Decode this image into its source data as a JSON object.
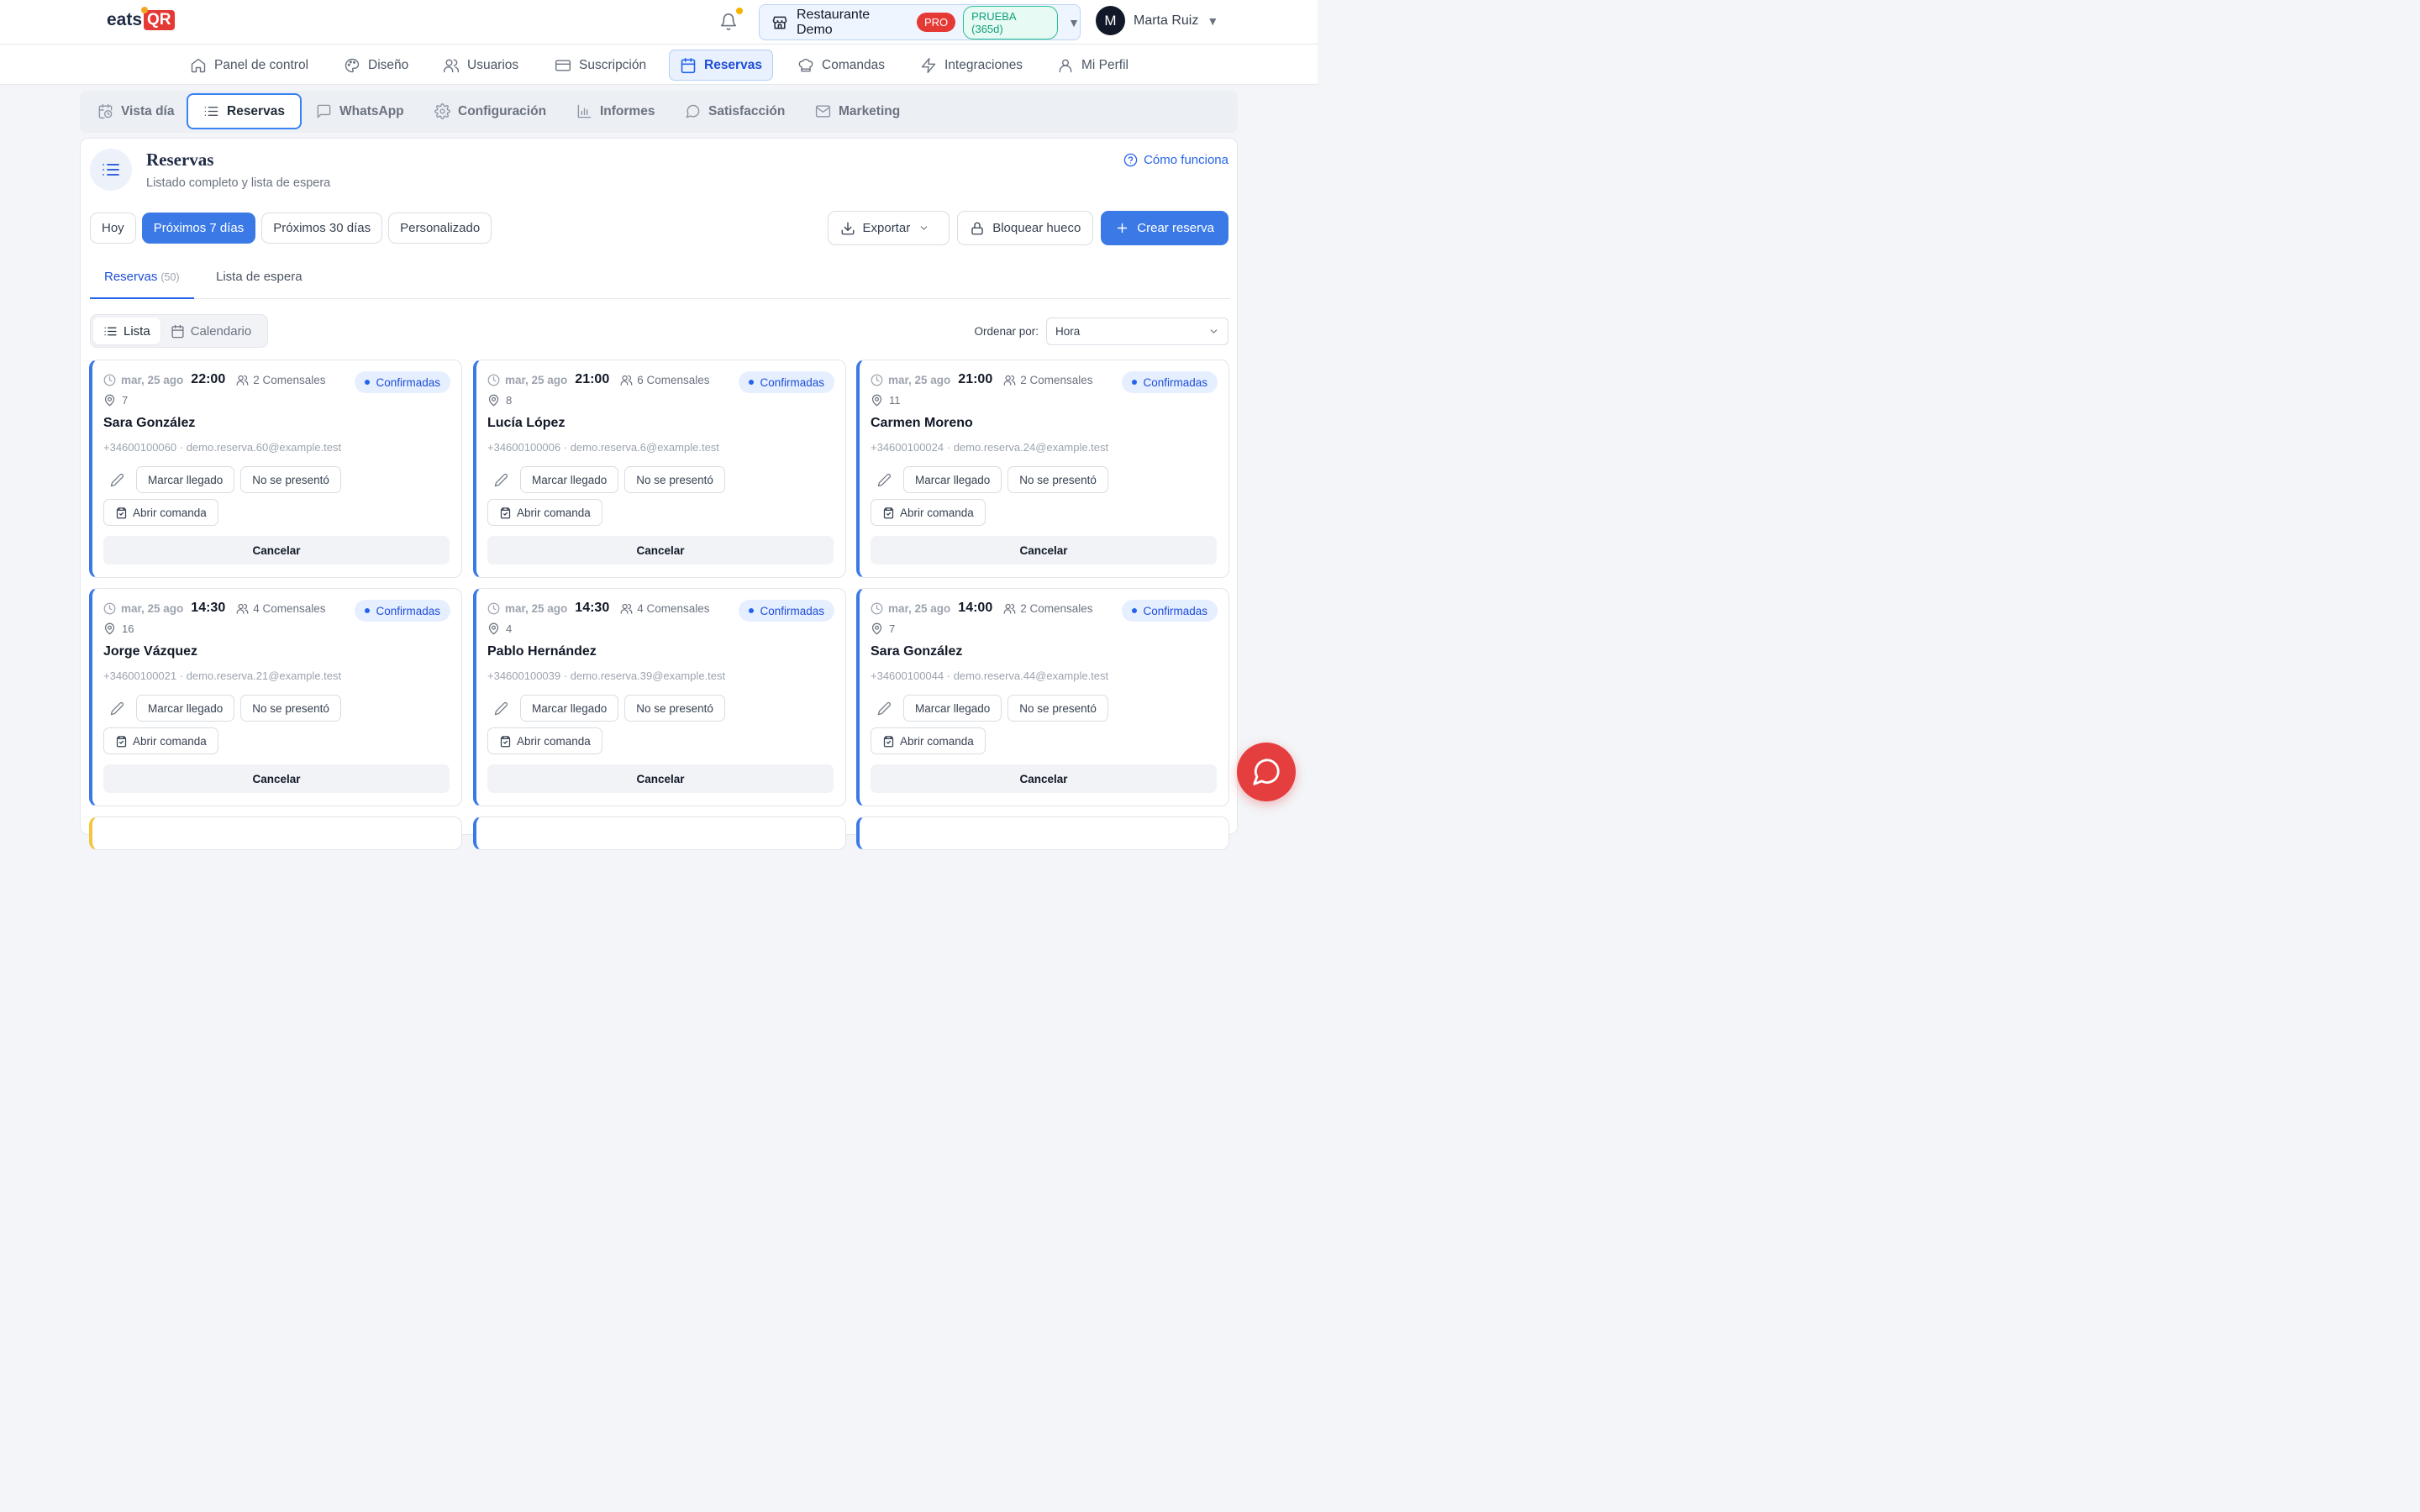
{
  "brand": {
    "name_part1": "eats",
    "name_part2": "QR"
  },
  "header": {
    "restaurant_name": "Restaurante Demo",
    "plan_badge": "PRO",
    "trial_badge": "PRUEBA (365d)",
    "user_initial": "M",
    "user_name": "Marta Ruiz"
  },
  "main_nav": [
    {
      "label": "Panel de control",
      "icon": "home-icon"
    },
    {
      "label": "Diseño",
      "icon": "palette-icon"
    },
    {
      "label": "Usuarios",
      "icon": "users-icon"
    },
    {
      "label": "Suscripción",
      "icon": "credit-card-icon"
    },
    {
      "label": "Reservas",
      "icon": "calendar-icon",
      "active": true
    },
    {
      "label": "Comandas",
      "icon": "chef-hat-icon"
    },
    {
      "label": "Integraciones",
      "icon": "bolt-icon"
    },
    {
      "label": "Mi Perfil",
      "icon": "user-icon"
    }
  ],
  "sub_nav": [
    {
      "label": "Vista día",
      "icon": "calendar-clock-icon"
    },
    {
      "label": "Reservas",
      "icon": "list-icon",
      "active": true
    },
    {
      "label": "WhatsApp",
      "icon": "message-square-icon"
    },
    {
      "label": "Configuración",
      "icon": "gear-icon"
    },
    {
      "label": "Informes",
      "icon": "bar-chart-icon"
    },
    {
      "label": "Satisfacción",
      "icon": "message-circle-icon"
    },
    {
      "label": "Marketing",
      "icon": "mail-icon"
    }
  ],
  "panel": {
    "title": "Reservas",
    "subtitle": "Listado completo y lista de espera",
    "help_link": "Cómo funciona"
  },
  "filters": [
    "Hoy",
    "Próximos 7 días",
    "Próximos 30 días",
    "Personalizado"
  ],
  "active_filter": "Próximos 7 días",
  "actions": {
    "export": "Exportar",
    "block": "Bloquear hueco",
    "create": "Crear reserva"
  },
  "tabs": {
    "reservations_label": "Reservas",
    "reservations_count": "(50)",
    "waitlist_label": "Lista de espera"
  },
  "view_toggle": {
    "list": "Lista",
    "calendar": "Calendario"
  },
  "sort": {
    "label": "Ordenar por:",
    "value": "Hora"
  },
  "card_labels": {
    "guests_suffix": "Comensales",
    "status": "Confirmadas",
    "arrived": "Marcar llegado",
    "no_show": "No se presentó",
    "open_order": "Abrir comanda",
    "cancel": "Cancelar"
  },
  "reservations": [
    {
      "date": "mar, 25 ago",
      "time": "22:00",
      "guests": "2 Comensales",
      "table": "7",
      "name": "Sara González",
      "phone": "+34600100060",
      "email": "demo.reserva.60@example.test"
    },
    {
      "date": "mar, 25 ago",
      "time": "21:00",
      "guests": "6 Comensales",
      "table": "8",
      "name": "Lucía López",
      "phone": "+34600100006",
      "email": "demo.reserva.6@example.test"
    },
    {
      "date": "mar, 25 ago",
      "time": "21:00",
      "guests": "2 Comensales",
      "table": "11",
      "name": "Carmen Moreno",
      "phone": "+34600100024",
      "email": "demo.reserva.24@example.test"
    },
    {
      "date": "mar, 25 ago",
      "time": "14:30",
      "guests": "4 Comensales",
      "table": "16",
      "name": "Jorge Vázquez",
      "phone": "+34600100021",
      "email": "demo.reserva.21@example.test"
    },
    {
      "date": "mar, 25 ago",
      "time": "14:30",
      "guests": "4 Comensales",
      "table": "4",
      "name": "Pablo Hernández",
      "phone": "+34600100039",
      "email": "demo.reserva.39@example.test"
    },
    {
      "date": "mar, 25 ago",
      "time": "14:00",
      "guests": "2 Comensales",
      "table": "7",
      "name": "Sara González",
      "phone": "+34600100044",
      "email": "demo.reserva.44@example.test"
    }
  ],
  "colors": {
    "accent": "#3b7ae6",
    "danger": "#e53935",
    "trial": "#0f9f79",
    "pending": "#f4c542"
  }
}
